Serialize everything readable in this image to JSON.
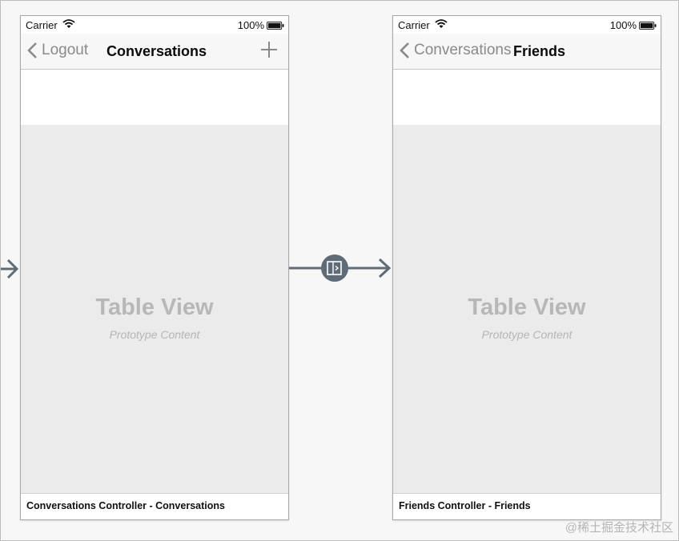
{
  "scenes": [
    {
      "status": {
        "carrier": "Carrier",
        "battery": "100%"
      },
      "nav": {
        "back_label": "Logout",
        "title": "Conversations",
        "add_icon": "plus-icon"
      },
      "table": {
        "title": "Table View",
        "subtitle": "Prototype Content"
      },
      "label": "Conversations Controller - Conversations"
    },
    {
      "status": {
        "carrier": "Carrier",
        "battery": "100%"
      },
      "nav": {
        "back_label": "Conversations",
        "title": "Friends"
      },
      "table": {
        "title": "Table View",
        "subtitle": "Prototype Content"
      },
      "label": "Friends Controller - Friends"
    }
  ],
  "segue": {
    "icon": "show-segue-icon"
  },
  "watermark": "@稀土掘金技术社区",
  "colors": {
    "canvas": "#f7f7f7",
    "table_bg": "#ebebeb",
    "segue": "#5f6b76"
  }
}
